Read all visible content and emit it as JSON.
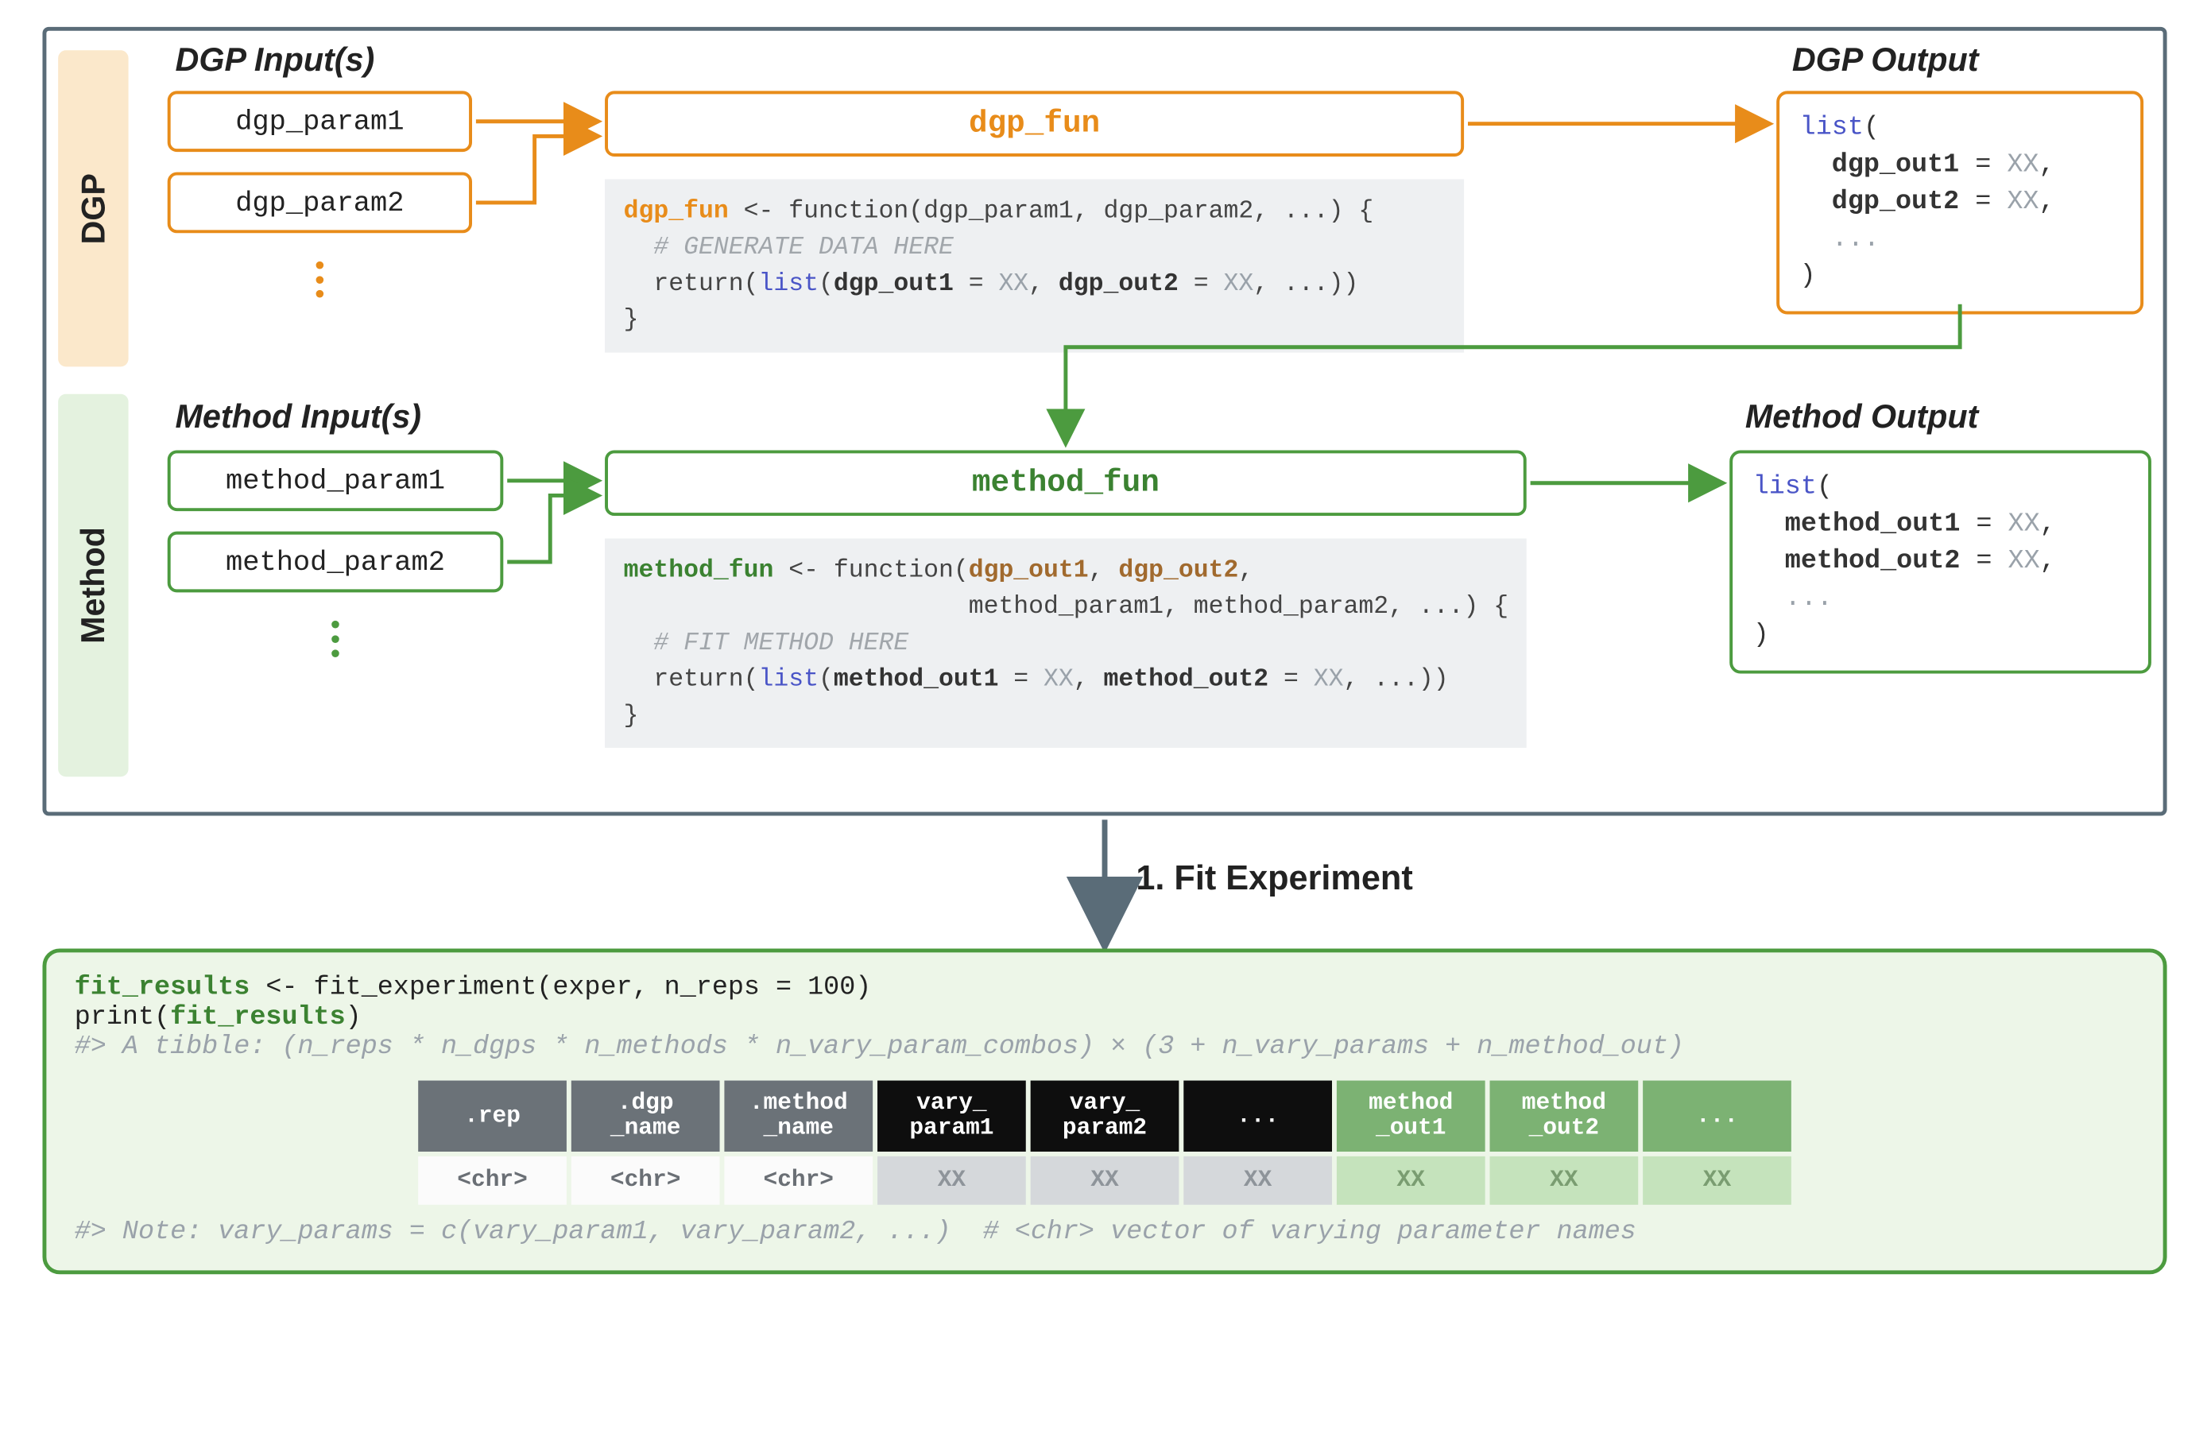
{
  "dgp": {
    "sidebar": "DGP",
    "inputs_title": "DGP Input(s)",
    "params": [
      "dgp_param1",
      "dgp_param2"
    ],
    "fun_label": "dgp_fun",
    "output_title": "DGP Output",
    "code": {
      "fn": "dgp_fun",
      "sig": " <- function(dgp_param1, dgp_param2, ...) {",
      "comment": "  # GENERATE DATA HERE",
      "ret_pre": "  return(",
      "ret_kw": "list",
      "ret_args_open": "(",
      "ret_k1": "dgp_out1",
      "ret_k2": "dgp_out2",
      "ret_eq": " = ",
      "ret_xx": "XX",
      "ret_close": ", ...))",
      "close": "}"
    },
    "output": {
      "kw": "list",
      "open": "(",
      "k1": "dgp_out1",
      "k2": "dgp_out2",
      "eq": " = ",
      "xx": "XX",
      "dots": "  ...",
      "close": ")"
    }
  },
  "method": {
    "sidebar": "Method",
    "inputs_title": "Method Input(s)",
    "params": [
      "method_param1",
      "method_param2"
    ],
    "fun_label": "method_fun",
    "output_title": "Method Output",
    "code": {
      "fn": "method_fun",
      "sig1": " <- function(",
      "dgp1": "dgp_out1",
      "dgp2": "dgp_out2",
      "sig1b": ", ",
      "sig1c": ",",
      "sig2": "                       method_param1, method_param2, ...) {",
      "comment": "  # FIT METHOD HERE",
      "ret_pre": "  return(",
      "ret_kw": "list",
      "ret_args_open": "(",
      "ret_k1": "method_out1",
      "ret_k2": "method_out2",
      "ret_eq": " = ",
      "ret_xx": "XX",
      "ret_close": ", ...))",
      "close": "}"
    },
    "output": {
      "kw": "list",
      "open": "(",
      "k1": "method_out1",
      "k2": "method_out2",
      "eq": " = ",
      "xx": "XX",
      "dots": "  ...",
      "close": ")"
    }
  },
  "fit": {
    "step_label": "1. Fit Experiment",
    "line1_a": "fit_results",
    "line1_b": " <- fit_experiment(exper, n_reps = 100)",
    "line2_a": "print(",
    "line2_b": "fit_results",
    "line2_c": ")",
    "tibble": "#> A tibble: (n_reps * n_dgps * n_methods * n_vary_param_combos) × (3 + n_vary_params + n_method_out)",
    "note": "#> Note: vary_params = c(vary_param1, vary_param2, ...)  # <chr> vector of varying parameter names",
    "table": {
      "headers": [
        {
          "cls": "grey",
          "text": ".rep"
        },
        {
          "cls": "grey",
          "l1": ".dgp",
          "l2": "_name"
        },
        {
          "cls": "grey",
          "l1": ".method",
          "l2": "_name"
        },
        {
          "cls": "black",
          "l1": "vary_",
          "l2": "param1"
        },
        {
          "cls": "black",
          "l1": "vary_",
          "l2": "param2"
        },
        {
          "cls": "black",
          "text": "..."
        },
        {
          "cls": "grn",
          "l1": "method",
          "l2": "_out1"
        },
        {
          "cls": "grn",
          "l1": "method",
          "l2": "_out2"
        },
        {
          "cls": "grn",
          "text": "..."
        }
      ],
      "row": [
        {
          "cls": "lgrey",
          "text": "<chr>"
        },
        {
          "cls": "lgrey",
          "text": "<chr>"
        },
        {
          "cls": "lgrey",
          "text": "<chr>"
        },
        {
          "cls": "mgrey",
          "text": "XX"
        },
        {
          "cls": "mgrey",
          "text": "XX"
        },
        {
          "cls": "mgrey",
          "text": "XX"
        },
        {
          "cls": "lgrn",
          "text": "XX"
        },
        {
          "cls": "lgrn",
          "text": "XX"
        },
        {
          "cls": "lgrn",
          "text": "XX"
        }
      ]
    }
  },
  "colors": {
    "orange": "#e88c1a",
    "green": "#4c9b3f",
    "slate": "#5a6c78"
  }
}
